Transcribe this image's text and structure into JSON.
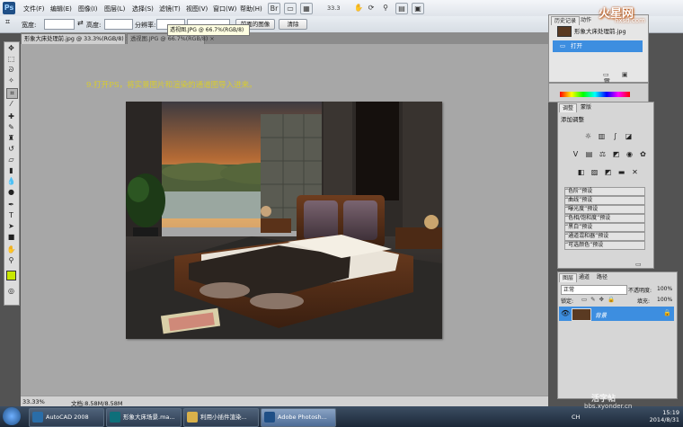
{
  "menubar": {
    "items": [
      "文件(F)",
      "编辑(E)",
      "图像(I)",
      "图层(L)",
      "选择(S)",
      "滤镜(T)",
      "视图(V)",
      "窗口(W)",
      "帮助(H)"
    ],
    "zoom": "33.3"
  },
  "options": {
    "width_label": "宽度:",
    "height_label": "高度:",
    "resolution_label": "分辨率:",
    "front_image_label": "前面的图像",
    "clear_label": "清除"
  },
  "tooltip": "透视图.JPG @ 66.7%(RGB/8)",
  "doc_tabs": [
    "形象大床处理前.jpg @ 33.3%(RGB/8) ×",
    "透视图.JPG @ 66.7%(RGB/8) ×"
  ],
  "instruction": "9.打开PS，将实景图片和渲染的通道图导入进来。",
  "status": {
    "zoom": "33.33%",
    "doc": "文档:8.58M/8.58M"
  },
  "history_panel": {
    "tabs": [
      "历史记录",
      "动作"
    ],
    "snapshot_label": "形象大床处理前.jpg",
    "open_label": "打开"
  },
  "adjustments_panel": {
    "tabs": [
      "调整",
      "蒙版"
    ],
    "title": "添加调整",
    "presets": [
      "“色阶”预设",
      "“曲线”预设",
      "“曝光度”预设",
      "“色相/饱和度”预设",
      "“黑白”预设",
      "“通道混和器”预设",
      "“可选颜色”预设"
    ]
  },
  "layers_panel": {
    "tabs": [
      "图层",
      "通道",
      "路径"
    ],
    "blend_mode": "正常",
    "opacity_label": "不透明度:",
    "opacity_value": "100%",
    "lock_label": "锁定:",
    "fill_label": "填充:",
    "fill_value": "100%",
    "layer_name": "背景"
  },
  "taskbar": {
    "apps": [
      "AutoCAD 2008",
      "形象大床场景.ma...",
      "利用小插件渲染...",
      "Adobe Photosh..."
    ],
    "clock_time": "15:19",
    "clock_date": "2014/8/31",
    "lang": "CH"
  },
  "watermark": {
    "brand": "火星网",
    "url": "hxsd.com",
    "bottom_text": "活字帖",
    "bottom_url": "bbs.xyonder.cn"
  },
  "colors": {
    "foreground_swatch": "#c8e800",
    "background_swatch": "#ffffff",
    "selection_blue": "#3d8ee0",
    "instruction_yellow": "#d9cc2d"
  },
  "icons": [
    "move-icon",
    "marquee-icon",
    "lasso-icon",
    "magic-wand-icon",
    "crop-icon",
    "eyedropper-icon",
    "healing-icon",
    "brush-icon",
    "stamp-icon",
    "history-brush-icon",
    "eraser-icon",
    "gradient-icon",
    "blur-icon",
    "dodge-icon",
    "pen-icon",
    "type-icon",
    "path-select-icon",
    "shape-icon",
    "hand-icon",
    "zoom-icon"
  ]
}
